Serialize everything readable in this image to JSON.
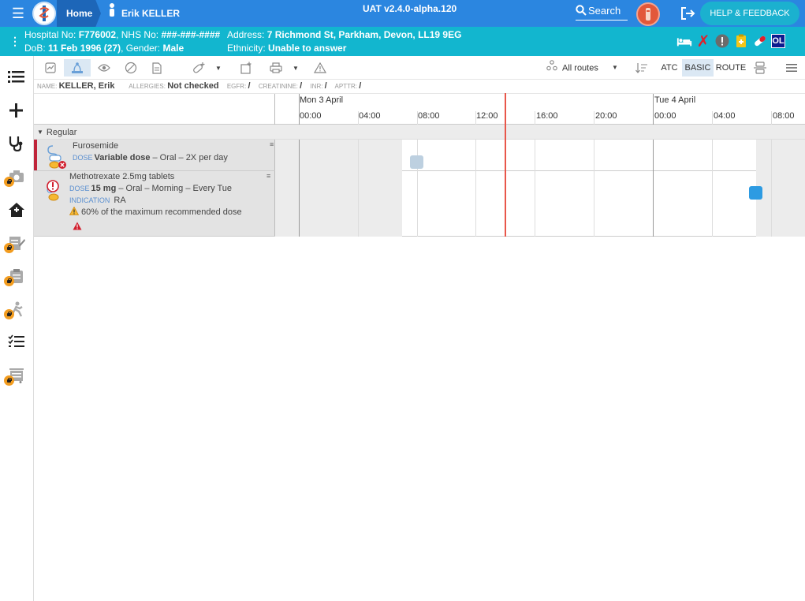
{
  "header": {
    "home_label": "Home",
    "patient_name": "Erik KELLER",
    "env_version": "UAT v2.4.0-alpha.120",
    "search_label": "Search",
    "help_label": "HELP & FEEDBACK"
  },
  "banner": {
    "hospital_no_label": "Hospital No:",
    "hospital_no": "F776002",
    "nhs_no_label": "NHS No:",
    "nhs_no": "###-###-####",
    "dob_label": "DoB:",
    "dob": "11 Feb 1996 (27)",
    "gender_label": "Gender:",
    "gender": "Male",
    "address_label": "Address:",
    "address": "7 Richmond St, Parkham, Devon, LL19 9EG",
    "ethnicity_label": "Ethnicity:",
    "ethnicity": "Unable to answer",
    "ol_badge": "OL"
  },
  "toolbar": {
    "routes_label": "All routes",
    "atc_label": "ATC",
    "basic_label": "BASIC",
    "route_label": "ROUTE"
  },
  "info": {
    "name_label": "NAME:",
    "name": "KELLER, Erik",
    "allergies_label": "ALLERGIES:",
    "allergies": "Not checked",
    "egfr_label": "EGFR:",
    "egfr": "/",
    "creatinine_label": "CREATININE:",
    "creatinine": "/",
    "inr_label": "INR:",
    "inr": "/",
    "apttr_label": "APTTR:",
    "apttr": "/"
  },
  "timeline": {
    "day1": "Mon 3 April",
    "day2": "Tue 4 April",
    "ticks": [
      "00:00",
      "04:00",
      "08:00",
      "12:00",
      "16:00",
      "20:00",
      "00:00",
      "04:00",
      "08:00"
    ]
  },
  "group_label": "Regular",
  "meds": [
    {
      "name": "Furosemide",
      "dose_label": "DOSE",
      "dose": "Variable dose",
      "details": " – Oral – 2X per day"
    },
    {
      "name": "Methotrexate 2.5mg tablets",
      "dose_label": "DOSE",
      "dose": "15 mg",
      "details": " – Oral – Morning – Every Tue",
      "indication_label": "INDICATION",
      "indication": "RA",
      "warning": "60% of the maximum recommended dose"
    }
  ],
  "colors": {
    "topbar": "#2b86e0",
    "banner": "#12b6cf",
    "now_line": "#e8564a",
    "dose_pending": "#bdd0e0",
    "dose_due": "#2d9be2"
  }
}
